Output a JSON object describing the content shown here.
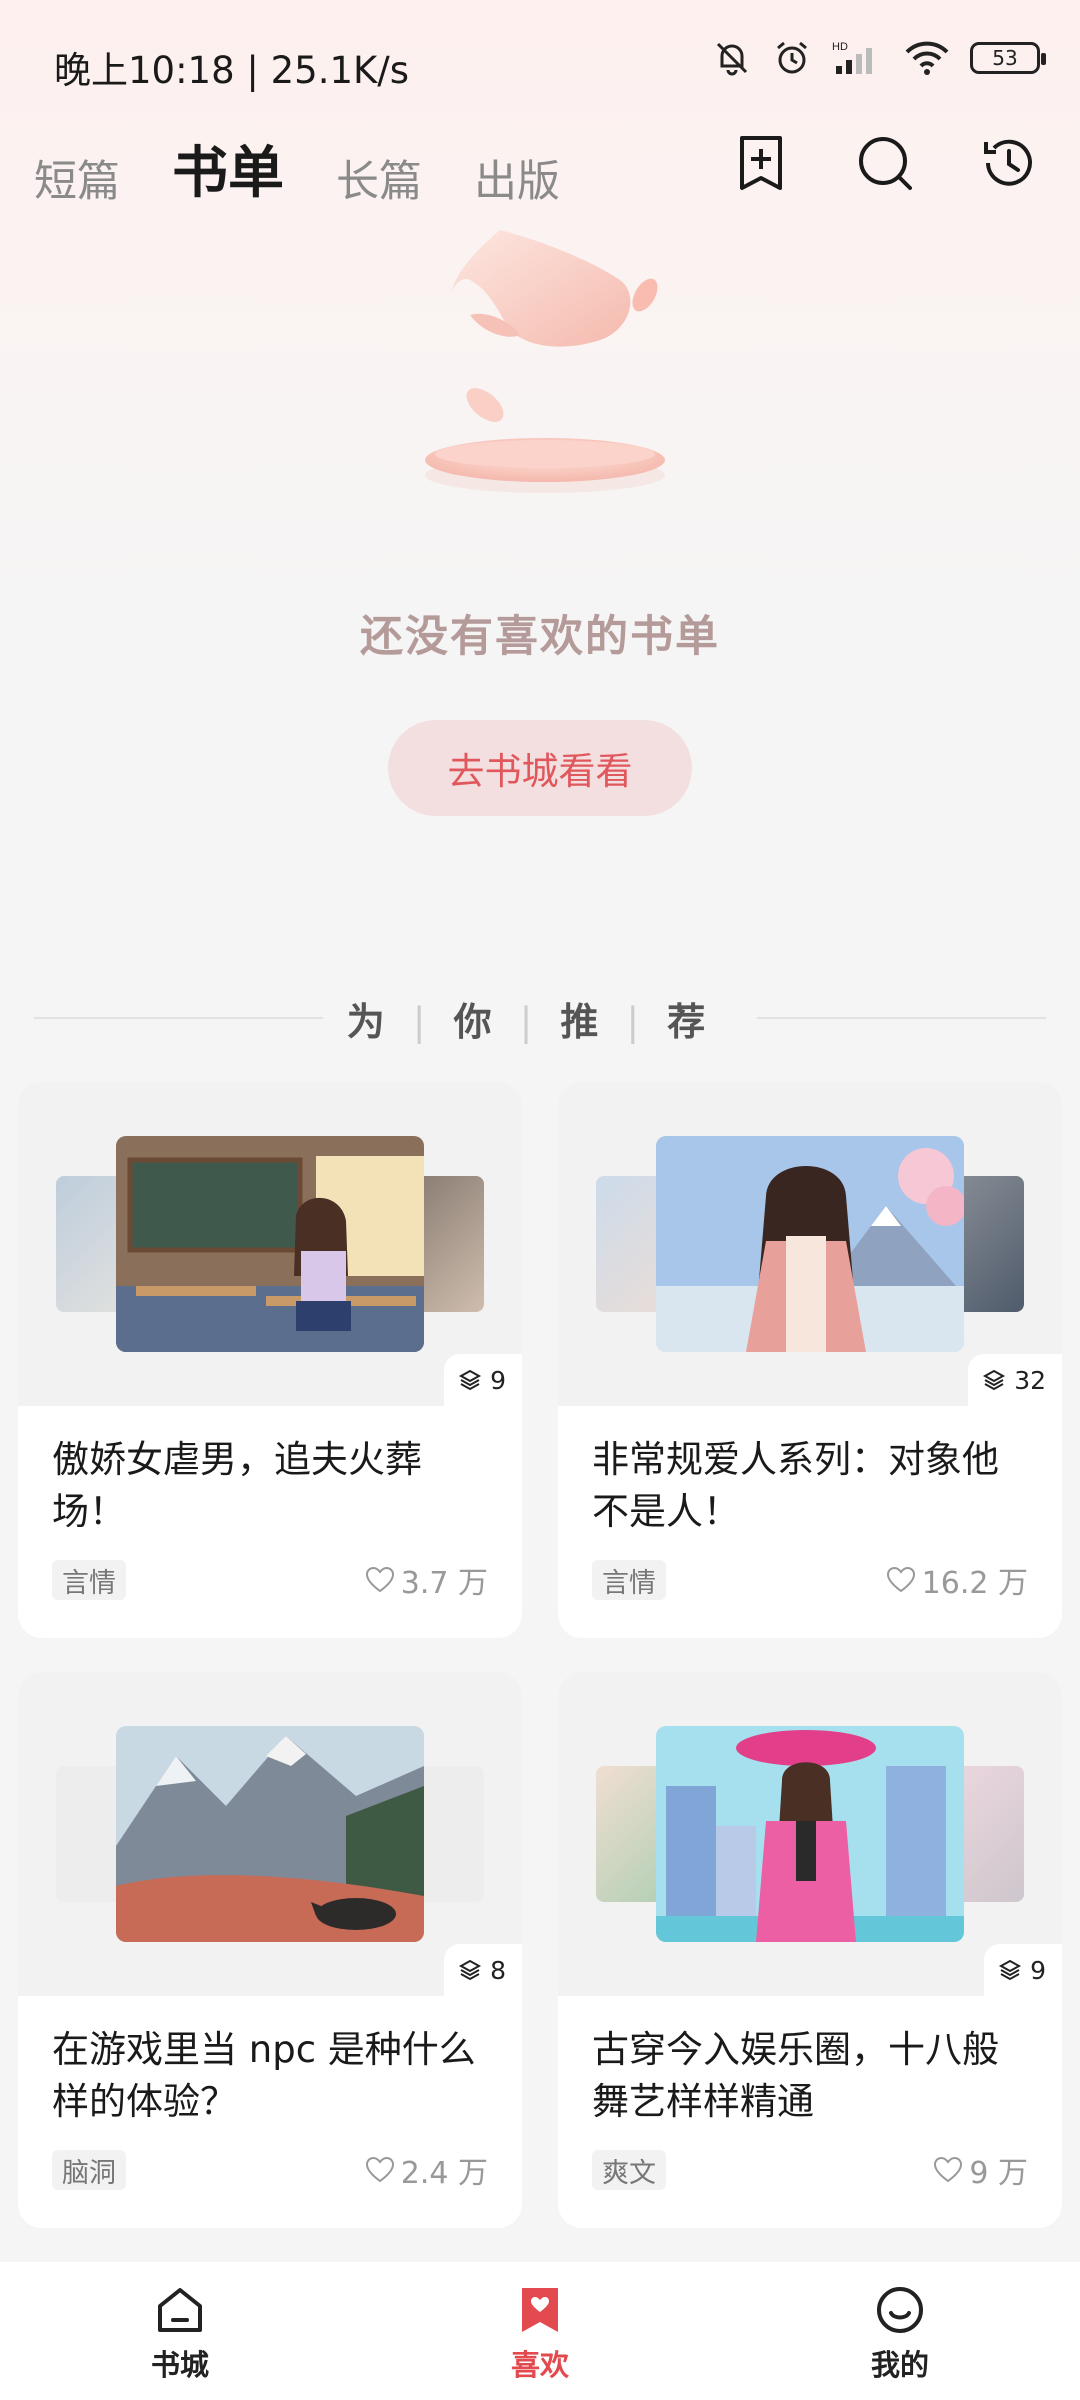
{
  "status_bar": {
    "time": "晚上10:18 | 25.1K/s",
    "battery": "53"
  },
  "tabs": [
    {
      "label": "短篇",
      "active": false
    },
    {
      "label": "书单",
      "active": true
    },
    {
      "label": "长篇",
      "active": false
    },
    {
      "label": "出版",
      "active": false
    }
  ],
  "top_actions": [
    "add-booklist-icon",
    "search-icon",
    "history-icon"
  ],
  "empty_state": {
    "message": "还没有喜欢的书单",
    "button_label": "去书城看看"
  },
  "recommend": {
    "chars": [
      "为",
      "你",
      "推",
      "荐"
    ]
  },
  "cards": [
    {
      "title": "傲娇女虐男，追夫火葬场！",
      "tag": "言情",
      "likes": "3.7 万",
      "count": "9"
    },
    {
      "title": "非常规爱人系列：对象他不是人！",
      "tag": "言情",
      "likes": "16.2 万",
      "count": "32"
    },
    {
      "title": "在游戏里当 npc 是种什么样的体验？",
      "tag": "脑洞",
      "likes": "2.4 万",
      "count": "8"
    },
    {
      "title": "古穿今入娱乐圈，十八般舞艺样样精通",
      "tag": "爽文",
      "likes": "9 万",
      "count": "9"
    }
  ],
  "bottom_nav": [
    {
      "label": "书城",
      "icon": "home-icon",
      "active": false
    },
    {
      "label": "喜欢",
      "icon": "heart-bookmark-icon",
      "active": true
    },
    {
      "label": "我的",
      "icon": "smile-icon",
      "active": false
    }
  ],
  "colors": {
    "accent": "#e24a4f",
    "button_bg": "#f3dfe0",
    "empty_text": "#b49a98"
  }
}
